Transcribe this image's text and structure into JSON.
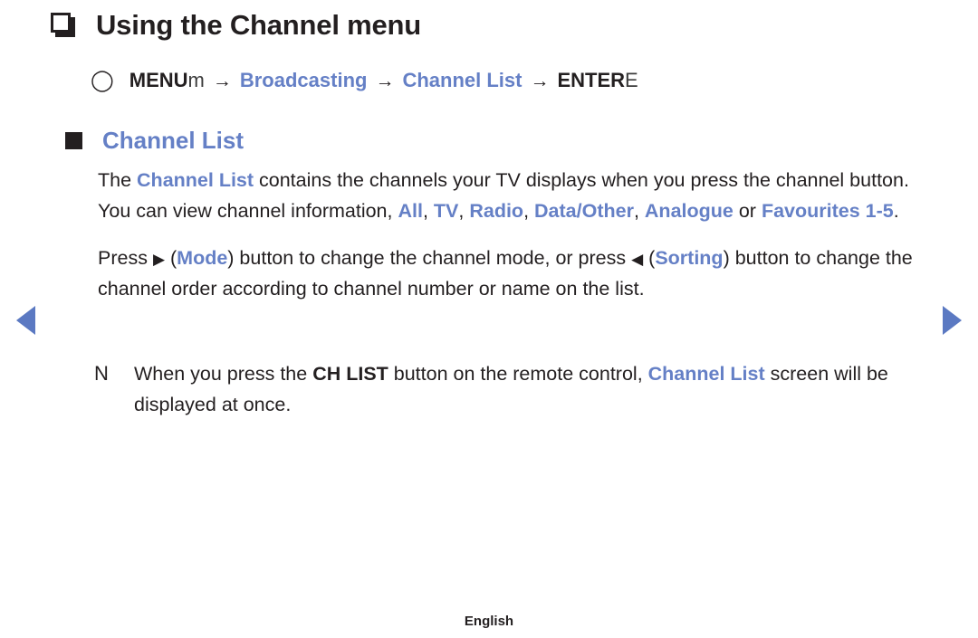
{
  "page": {
    "title": "Using the Channel menu",
    "title_bullet_icon": "hollow-square-bullet-icon"
  },
  "menu_path": {
    "circle_icon": "circle-outline-icon",
    "menu_label": "MENU",
    "menu_symbol": "m",
    "arrow1": "→",
    "step1": "Broadcasting",
    "arrow2": "→",
    "step2": "Channel List",
    "arrow3": "→",
    "enter_label": "ENTER",
    "enter_symbol": "E"
  },
  "section": {
    "bullet_icon": "filled-square-bullet-icon",
    "heading": "Channel List"
  },
  "paragraphs": {
    "p1": {
      "t1": "The ",
      "a1": "Channel List",
      "t2": " contains the channels your TV displays when you press the channel button. You can view channel information, ",
      "a2": "All",
      "t3": ", ",
      "a3": "TV",
      "t4": ", ",
      "a4": "Radio",
      "t5": ", ",
      "a5": "Data/Other",
      "t6": ", ",
      "a6": "Analogue",
      "t7": " or ",
      "a7": "Favourites 1-5",
      "t8": "."
    },
    "p2": {
      "t1": "Press ",
      "icon_right": "▶",
      "t2": " (",
      "a1": "Mode",
      "t3": ") button to change the channel mode, or press ",
      "icon_left": "◀",
      "t4": " (",
      "a2": "Sorting",
      "t5": ") button to change the channel order according to channel number or name on the list."
    }
  },
  "note": {
    "icon": "N",
    "t1": "When you press the ",
    "b1": "CH LIST",
    "t2": " button on the remote control, ",
    "a1": "Channel List",
    "t3": " screen will be displayed at once."
  },
  "nav": {
    "prev_icon": "triangle-left-icon",
    "next_icon": "triangle-right-icon"
  },
  "footer": {
    "language": "English"
  },
  "colors": {
    "accent_blue": "#6580c6",
    "nav_blue": "#5b79c2",
    "text_black": "#231f20"
  }
}
